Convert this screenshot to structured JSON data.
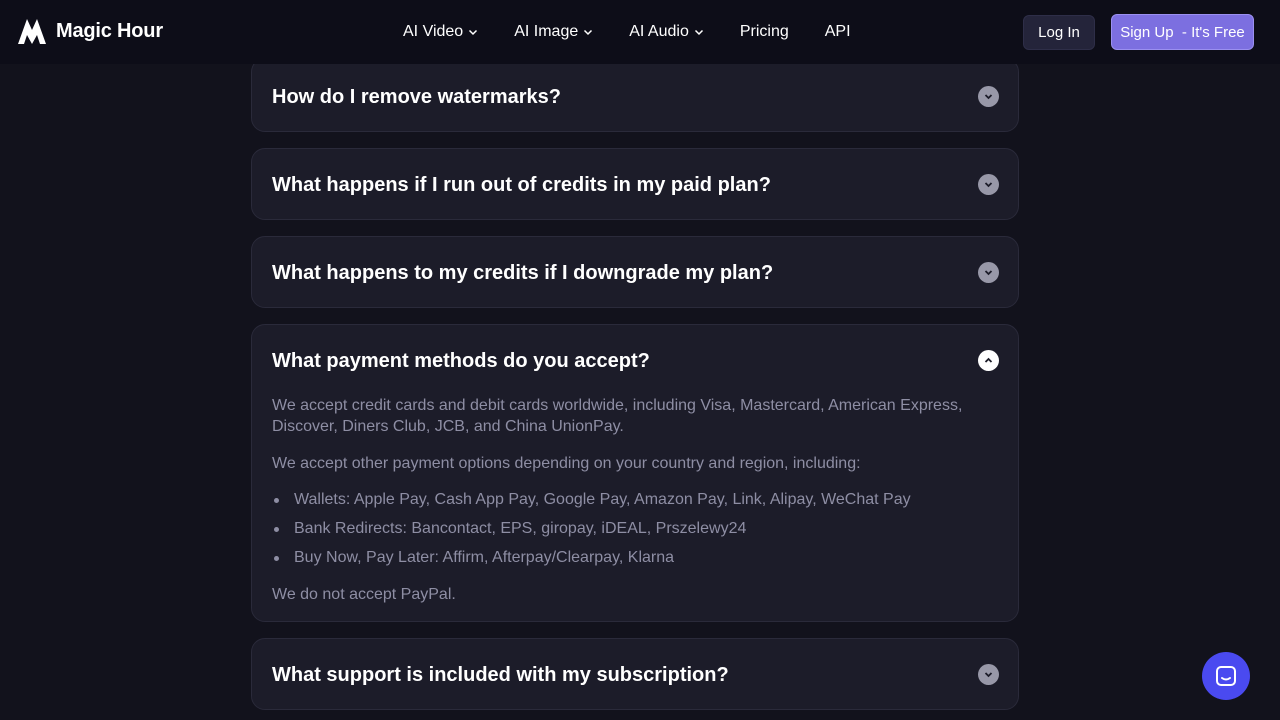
{
  "brand": {
    "name": "Magic Hour",
    "logo_icon": "magic-hour-logo-icon"
  },
  "nav": {
    "items": [
      {
        "label": "AI Video",
        "has_dropdown": true
      },
      {
        "label": "AI Image",
        "has_dropdown": true
      },
      {
        "label": "AI Audio",
        "has_dropdown": true
      },
      {
        "label": "Pricing",
        "has_dropdown": false
      },
      {
        "label": "API",
        "has_dropdown": false
      }
    ],
    "login_label": "Log In",
    "signup_label": "Sign Up  - It's Free"
  },
  "faq": {
    "items": [
      {
        "question": "How do I remove watermarks?",
        "expanded": false
      },
      {
        "question": "What happens if I run out of credits in my paid plan?",
        "expanded": false
      },
      {
        "question": "What happens to my credits if I downgrade my plan?",
        "expanded": false
      },
      {
        "question": "What payment methods do you accept?",
        "expanded": true,
        "answer": {
          "p1": "We accept credit cards and debit cards worldwide, including Visa, Mastercard, American Express, Discover, Diners Club, JCB, and China UnionPay.",
          "p2": "We accept other payment options depending on your country and region, including:",
          "bullets": [
            "Wallets: Apple Pay, Cash App Pay, Google Pay, Amazon Pay, Link, Alipay, WeChat Pay",
            "Bank Redirects: Bancontact, EPS, giropay, iDEAL, Prszelewy24",
            "Buy Now, Pay Later: Affirm, Afterpay/Clearpay, Klarna"
          ],
          "p3": "We do not accept PayPal."
        }
      },
      {
        "question": "What support is included with my subscription?",
        "expanded": false
      }
    ]
  },
  "colors": {
    "background": "#12121c",
    "navbar": "#0d0d18",
    "card": "#1c1c29",
    "accent": "#7c6fe0",
    "chat": "#4a4af0",
    "muted_text": "#8e8ea4"
  },
  "chat_icon": "chat-icon"
}
